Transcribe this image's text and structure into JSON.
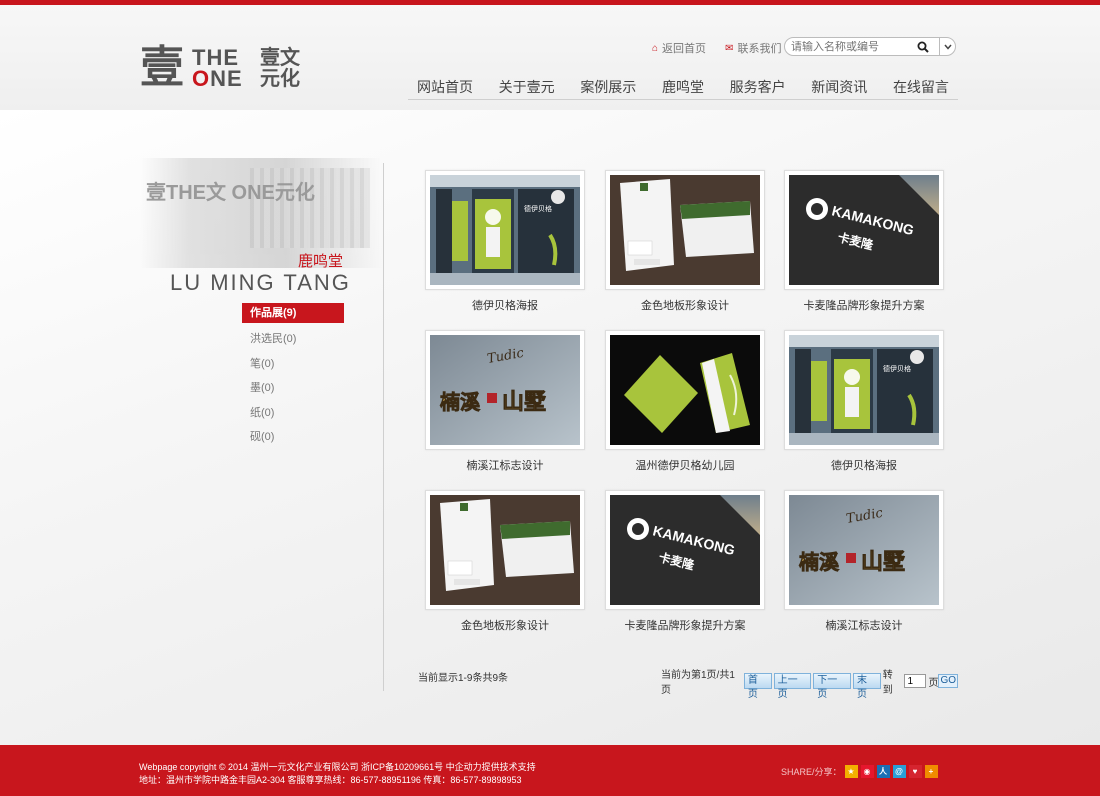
{
  "logo": {
    "mark": "壹",
    "the": "THE",
    "one_o": "O",
    "one_ne": "NE",
    "cn1": "壹文",
    "cn2": "元化"
  },
  "toplinks": {
    "home": "返回首页",
    "contact": "联系我们"
  },
  "search": {
    "placeholder": "请输入名称或编号",
    "button": "Q",
    "dropdown": "⌄"
  },
  "nav": [
    "网站首页",
    "关于壹元",
    "案例展示",
    "鹿鸣堂",
    "服务客户",
    "新闻资讯",
    "在线留言"
  ],
  "sidebar": {
    "photo_logo": "壹THE文 ONE元化",
    "title_cn": "鹿鸣堂",
    "title_en": "LU MING TANG",
    "items": [
      {
        "label": "作品展(9)",
        "active": true
      },
      {
        "label": "洪选民(0)",
        "active": false
      },
      {
        "label": "笔(0)",
        "active": false
      },
      {
        "label": "墨(0)",
        "active": false
      },
      {
        "label": "纸(0)",
        "active": false
      },
      {
        "label": "砚(0)",
        "active": false
      }
    ]
  },
  "works": [
    {
      "caption": "德伊贝格海报",
      "thumb": "posters"
    },
    {
      "caption": "金色地板形象设计",
      "thumb": "stationery"
    },
    {
      "caption": "卡麦隆品牌形象提升方案",
      "thumb": "kamakong"
    },
    {
      "caption": "楠溪江标志设计",
      "thumb": "villa"
    },
    {
      "caption": "温州德伊贝格幼儿园",
      "thumb": "brochure"
    },
    {
      "caption": "德伊贝格海报",
      "thumb": "posters"
    },
    {
      "caption": "金色地板形象设计",
      "thumb": "stationery"
    },
    {
      "caption": "卡麦隆品牌形象提升方案",
      "thumb": "kamakong"
    },
    {
      "caption": "楠溪江标志设计",
      "thumb": "villa"
    }
  ],
  "thumb_text": {
    "kamakong": "KAMAKONG",
    "kamakong_cn": "卡麦隆",
    "villa_cn": "楠溪",
    "villa_cn2": "山墅",
    "villa_script": "Tudic",
    "poster_cn": "德伊贝格"
  },
  "pager": {
    "summary": "当前显示1-9条共9条",
    "current": "当前为第1页/共1页",
    "first": "首页",
    "prev": "上一页",
    "next": "下一页",
    "last": "末页",
    "goto": "转到",
    "page_value": "1",
    "page_unit": "页",
    "go": "GO"
  },
  "footer": {
    "line1": "Webpage copyright © 2014 温州一元文化产业有限公司 浙ICP备10209661号 中企动力提供技术支持",
    "line2": "地址：温州市学院中路金丰园A2-304   客服尊享热线：86-577-88951196   传真：86-577-89898953",
    "share_label": "SHARE/分享：",
    "share_icons": [
      {
        "name": "qzone-icon",
        "glyph": "★",
        "color": "#f3b000"
      },
      {
        "name": "sina-weibo-icon",
        "glyph": "◉",
        "color": "#e6162d"
      },
      {
        "name": "renren-icon",
        "glyph": "人",
        "color": "#1a6fb5"
      },
      {
        "name": "tencent-weibo-icon",
        "glyph": "@",
        "color": "#2a9fd6"
      },
      {
        "name": "kaixin-icon",
        "glyph": "♥",
        "color": "#d5242f"
      },
      {
        "name": "more-share-icon",
        "glyph": "+",
        "color": "#f08c00"
      }
    ]
  },
  "colors": {
    "brand_red": "#c8161d",
    "text": "#333333",
    "poster_green": "#a8c43c"
  }
}
